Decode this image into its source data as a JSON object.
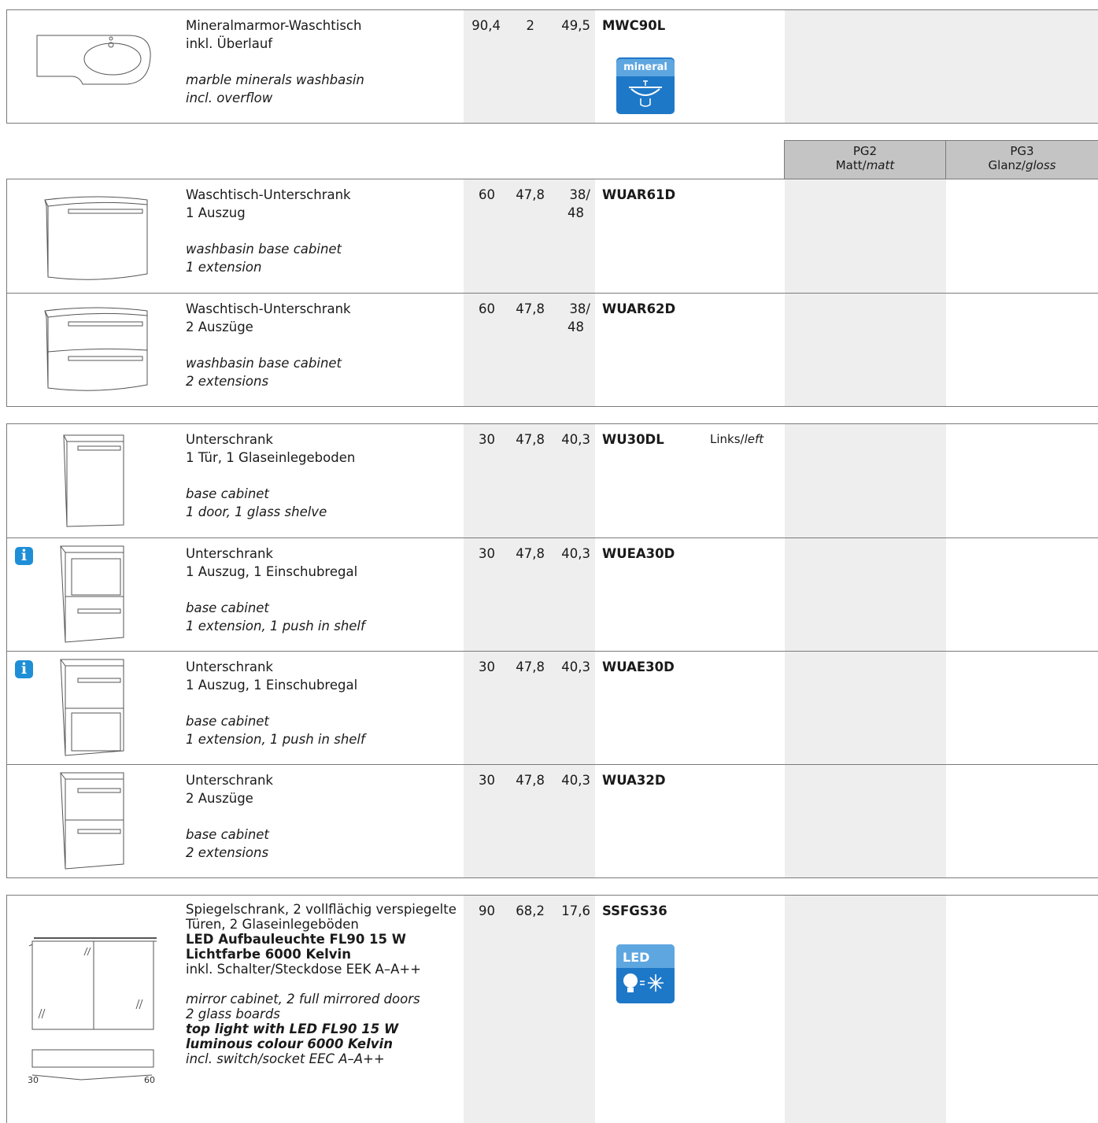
{
  "columns": {
    "pg2": {
      "code": "PG2",
      "label": "Matt",
      "label_en": "matt"
    },
    "pg3": {
      "code": "PG3",
      "label": "Glanz",
      "label_en": "gloss"
    }
  },
  "products": [
    {
      "de": [
        "Mineralmarmor-Waschtisch",
        "inkl. Überlauf"
      ],
      "en": [
        "marble minerals washbasin",
        "incl. overflow"
      ],
      "w": "90,4",
      "h": "2",
      "d": "49,5",
      "article": "MWC90L",
      "badge": "mineral"
    },
    {
      "de": [
        "Waschtisch-Unterschrank",
        "1 Auszug"
      ],
      "en": [
        "washbasin base cabinet",
        "1 extension"
      ],
      "w": "60",
      "h": "47,8",
      "d": [
        "38/",
        "48"
      ],
      "article": "WUAR61D"
    },
    {
      "de": [
        "Waschtisch-Unterschrank",
        "2 Auszüge"
      ],
      "en": [
        "washbasin base cabinet",
        "2 extensions"
      ],
      "w": "60",
      "h": "47,8",
      "d": [
        "38/",
        "48"
      ],
      "article": "WUAR62D"
    },
    {
      "de": [
        "Unterschrank",
        "1 Tür, 1 Glaseinlegeboden"
      ],
      "en": [
        "base cabinet",
        "1 door, 1 glass shelve"
      ],
      "w": "30",
      "h": "47,8",
      "d": "40,3",
      "article": "WU30DL",
      "side": "Links",
      "side_en": "left"
    },
    {
      "de": [
        "Unterschrank",
        "1 Auszug, 1 Einschubregal"
      ],
      "en": [
        "base cabinet",
        "1 extension, 1 push in shelf"
      ],
      "w": "30",
      "h": "47,8",
      "d": "40,3",
      "article": "WUEA30D",
      "info": "i"
    },
    {
      "de": [
        "Unterschrank",
        "1 Auszug, 1 Einschubregal"
      ],
      "en": [
        "base cabinet",
        "1 extension, 1 push in shelf"
      ],
      "w": "30",
      "h": "47,8",
      "d": "40,3",
      "article": "WUAE30D",
      "info": "i"
    },
    {
      "de": [
        "Unterschrank",
        "2 Auszüge"
      ],
      "en": [
        "base cabinet",
        "2 extensions"
      ],
      "w": "30",
      "h": "47,8",
      "d": "40,3",
      "article": "WUA32D"
    },
    {
      "de": [
        "Spiegelschrank, 2 vollflächig verspiegelte",
        "Türen, 2 Glaseinlegeböden"
      ],
      "de_bold": [
        "LED Aufbauleuchte FL90 15 W",
        "Lichtfarbe 6000 Kelvin"
      ],
      "de_tail": "inkl. Schalter/Steckdose EEK  A–A++",
      "en": [
        "mirror cabinet, 2 full mirrored doors",
        "2 glass boards"
      ],
      "en_bold": [
        "top light with LED FL90 15 W",
        "luminous colour 6000 Kelvin"
      ],
      "en_tail": "incl. switch/socket EEC  A–A++",
      "w": "90",
      "h": "68,2",
      "d": "17,6",
      "article": "SSFGS36",
      "badge": "LED",
      "dim_left": "30",
      "dim_right": "60"
    }
  ],
  "colors": {
    "border": "#7a7a7a",
    "shade": "#eeeeee",
    "header": "#c4c4c4",
    "badge_blue": "#1e78c8",
    "info_blue": "#1e8fd6"
  }
}
